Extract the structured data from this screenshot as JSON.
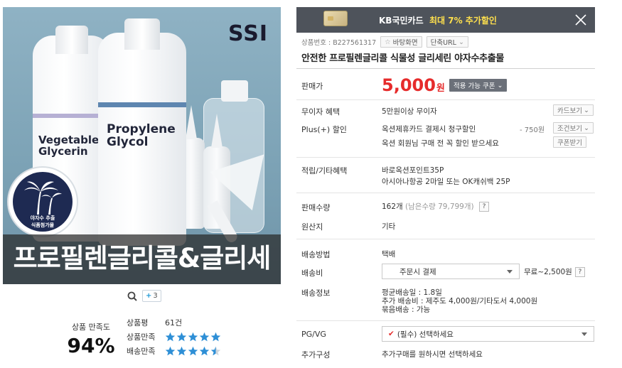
{
  "product_image": {
    "brand": "SSI",
    "bottle_left_name_1": "Vegetable",
    "bottle_left_name_2": "Glycerin",
    "bottle_right_name_1": "Propylene",
    "bottle_right_name_2": "Glycol",
    "badge_line_1": "야자수 추출",
    "badge_line_2": "식품첨가물",
    "banner": "프로필렌글리콜&글리세린"
  },
  "image_tools": {
    "thumb_count": "3"
  },
  "ratings": {
    "satisfaction_label": "상품 만족도",
    "satisfaction_value": "94%",
    "review_label": "상품평",
    "review_count": "61건",
    "product_label": "상품만족",
    "product_stars": 5,
    "delivery_label": "배송만족",
    "delivery_stars": 4.5
  },
  "promo": {
    "card_name": "KB국민카드",
    "offer": "최대 7% 추가할인"
  },
  "meta": {
    "product_no": "상품번호 : B227561317",
    "wallpaper_btn": "바탕화면",
    "short_url_btn": "단축URL"
  },
  "product_title": "안전한 프로필렌글리콜 식물성 글리세린 야자수추출물",
  "price": {
    "label": "판매가",
    "amount": "5,000",
    "unit": "원",
    "coupon_btn": "적용 가능 쿠폰"
  },
  "benefits": {
    "free_ship_label": "무이자 혜택",
    "free_ship_value": "5만원이상 무이자",
    "card_btn": "카드보기",
    "plus_label": "Plus(+) 할인",
    "plus_value": "옥션제휴카드 결제시 청구할인",
    "plus_amount": "- 750원",
    "condition_btn": "조건보기",
    "member_value": "옥션 회원님 구매 전 꼭 할인 받으세요",
    "coupon_get_btn": "쿠폰받기"
  },
  "points": {
    "label": "적립/기타혜택",
    "line1": "바로옥션포인트35P",
    "line2": "아시아나항공 2마일 또는 OK캐쉬백 25P"
  },
  "sales": {
    "label": "판매수량",
    "count": "162개",
    "remain": "(남은수량 79,799개)",
    "origin_label": "원산지",
    "origin_value": "기타"
  },
  "shipping": {
    "method_label": "배송방법",
    "method_value": "택배",
    "fee_label": "배송비",
    "fee_select": "주문시 결제",
    "fee_value": "무료~2,500원",
    "info_label": "배송정보",
    "info_line1": "평균배송일 : 1.8일",
    "info_line2": "추가 배송비 : 제주도 4,000원/기타도서 4,000원",
    "info_line3": "묶음배송 : 가능"
  },
  "options": {
    "pg_label": "PG/VG",
    "pg_select": "(필수) 선택하세요",
    "extra_label": "추가구성",
    "extra_value": "추가구매를 원하시면 선택하세요"
  },
  "colors": {
    "price_red": "#e62b2b",
    "promo_bg": "#4e535b",
    "promo_highlight": "#ffe04d",
    "star_blue": "#2e8fd6"
  }
}
